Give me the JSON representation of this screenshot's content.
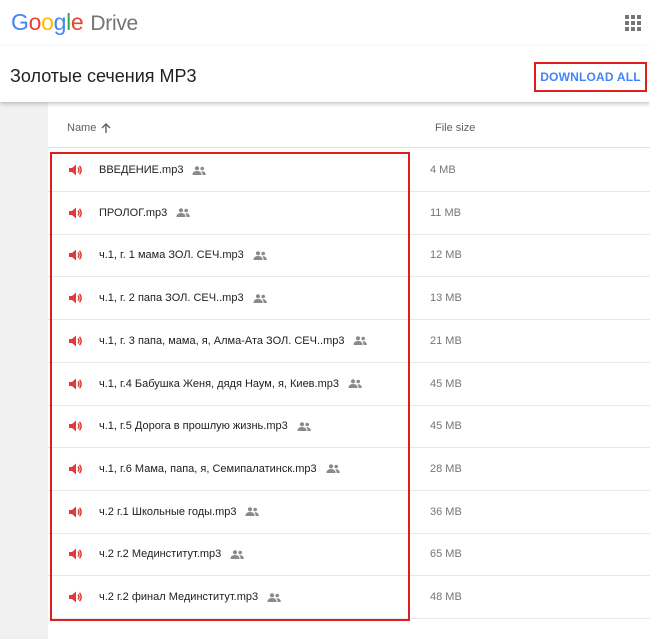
{
  "app": {
    "logo_google": [
      "G",
      "o",
      "o",
      "g",
      "l",
      "e"
    ],
    "logo_product": "Drive"
  },
  "header": {
    "folder_title": "Золотые сечения MP3",
    "download_all_label": "DOWNLOAD ALL"
  },
  "columns": {
    "name": "Name",
    "size": "File size"
  },
  "colors": {
    "accent": "#4285f4",
    "audio_icon": "#e53935",
    "highlight": "#e01e1e"
  },
  "files": [
    {
      "name": "ВВЕДЕНИЕ.mp3",
      "size": "4 MB",
      "icon": "audio-icon",
      "shared": true
    },
    {
      "name": "ПРОЛОГ.mp3",
      "size": "11 MB",
      "icon": "audio-icon",
      "shared": true
    },
    {
      "name": "ч.1, г. 1 мама ЗОЛ. СЕЧ.mp3",
      "size": "12 MB",
      "icon": "audio-icon",
      "shared": true
    },
    {
      "name": "ч.1, г. 2 папа ЗОЛ. СЕЧ..mp3",
      "size": "13 MB",
      "icon": "audio-icon",
      "shared": true
    },
    {
      "name": "ч.1, г. 3 папа, мама, я, Алма-Ата ЗОЛ. СЕЧ..mp3",
      "size": "21 MB",
      "icon": "audio-icon",
      "shared": true
    },
    {
      "name": "ч.1, г.4 Бабушка Женя, дядя Наум, я, Киев.mp3",
      "size": "45 MB",
      "icon": "audio-icon",
      "shared": true
    },
    {
      "name": "ч.1, г.5 Дорога в прошлую жизнь.mp3",
      "size": "45 MB",
      "icon": "audio-icon",
      "shared": true
    },
    {
      "name": "ч.1, г.6 Мама, папа, я, Семипалатинск.mp3",
      "size": "28 MB",
      "icon": "audio-icon",
      "shared": true
    },
    {
      "name": "ч.2 г.1 Школьные годы.mp3",
      "size": "36 MB",
      "icon": "audio-icon",
      "shared": true
    },
    {
      "name": "ч.2 г.2 Мединститут.mp3",
      "size": "65 MB",
      "icon": "audio-icon",
      "shared": true
    },
    {
      "name": "ч.2 г.2 финал Мединститут.mp3",
      "size": "48 MB",
      "icon": "audio-icon",
      "shared": true
    }
  ]
}
